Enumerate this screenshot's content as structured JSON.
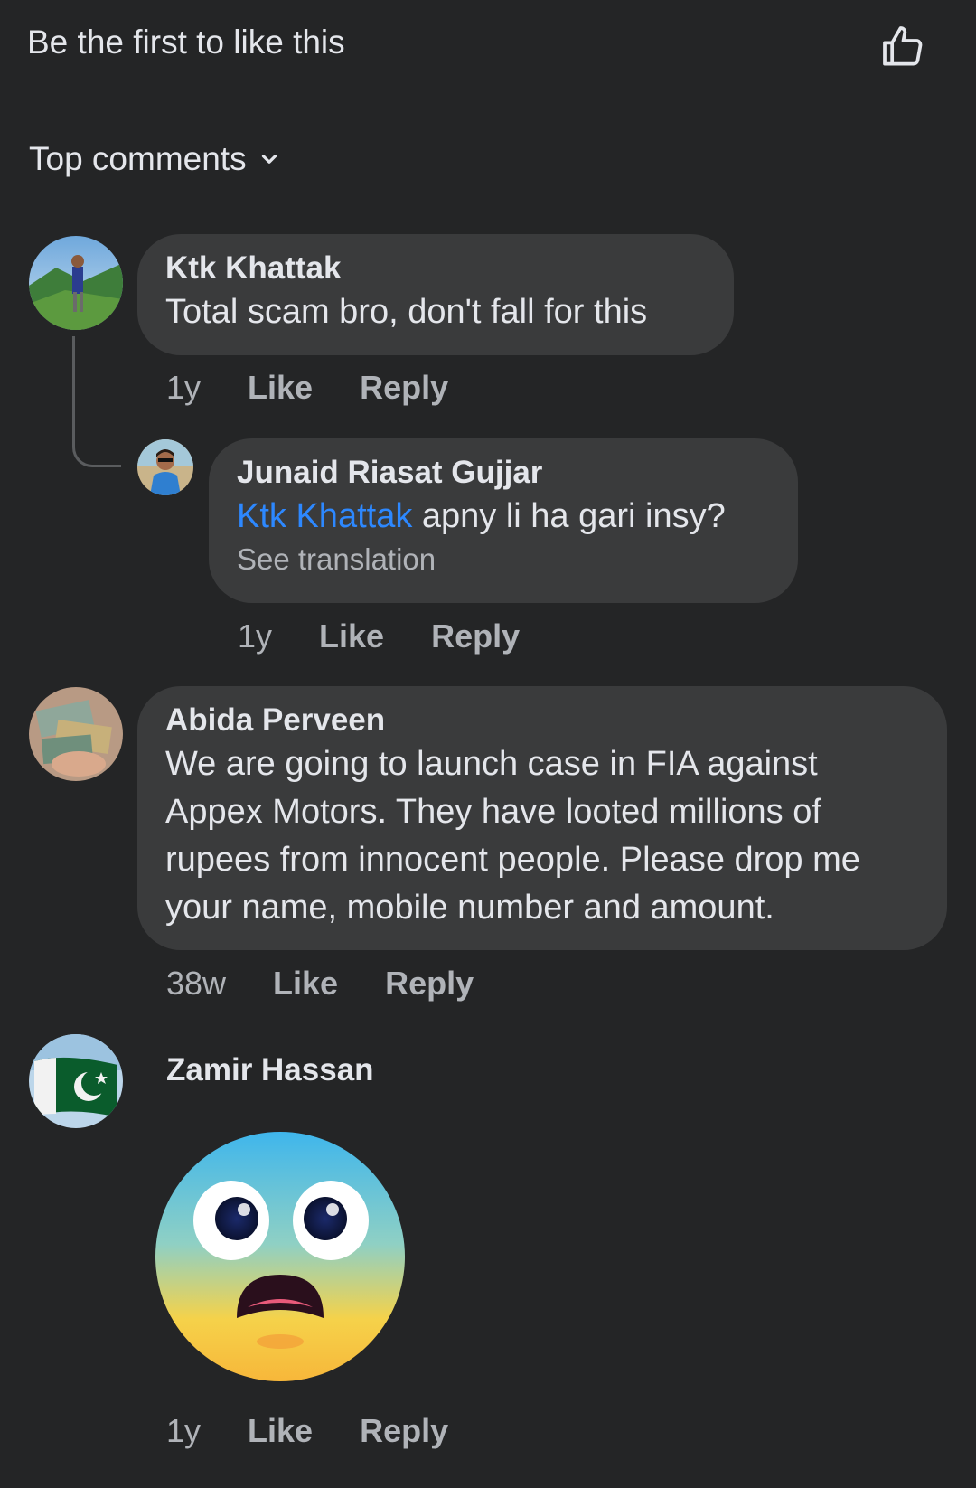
{
  "header": {
    "likes_text": "Be the first to like this",
    "like_icon": "thumbs-up-outline-icon"
  },
  "sort": {
    "label": "Top comments",
    "icon": "chevron-down-icon"
  },
  "comments": [
    {
      "author": "Ktk Khattak",
      "text": "Total scam bro, don't fall for this",
      "time": "1y",
      "like_label": "Like",
      "reply_label": "Reply"
    },
    {
      "author": "Junaid Riasat Gujjar",
      "mention": "Ktk Khattak",
      "text": " apny li ha gari insy?",
      "see_translation": "See translation",
      "time": "1y",
      "like_label": "Like",
      "reply_label": "Reply"
    },
    {
      "author": "Abida Perveen",
      "text": "We are going to launch case in FIA against Appex Motors. They have looted millions of rupees from innocent people. Please drop me your name, mobile number and amount.",
      "time": "38w",
      "like_label": "Like",
      "reply_label": "Reply"
    },
    {
      "author": "Zamir Hassan",
      "sticker": "fearful-face-emoji-icon",
      "time": "1y",
      "like_label": "Like",
      "reply_label": "Reply"
    }
  ],
  "colors": {
    "background": "#242526",
    "bubble": "#3a3b3c",
    "primary_text": "#e4e6eb",
    "secondary_text": "#b0b3b8",
    "mention": "#2d88ff"
  }
}
